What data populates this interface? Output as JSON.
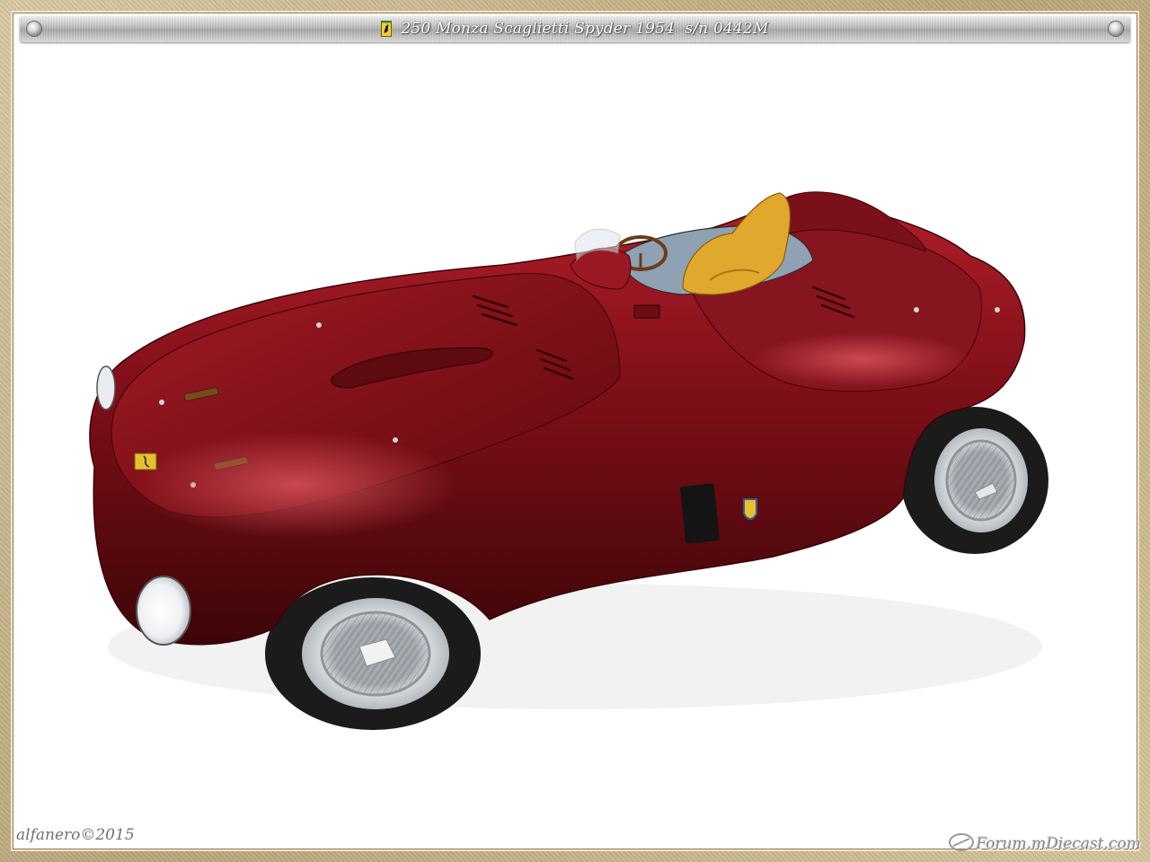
{
  "title_bar": {
    "title": "250 Monza Scaglietti Spyder 1954  s/n 0442M",
    "emblem_icon": "prancing-horse-badge-icon"
  },
  "watermark": {
    "signature": "alfanero©2015",
    "forum": "Forum.mDiecast.com"
  },
  "photo": {
    "subject": "car-model",
    "colors": {
      "body": "#7a0f17",
      "seats": "#e0a82c",
      "interior": "#8fa2b3",
      "wheel_rim": "#c9cdd1",
      "tire": "#1c1c1c"
    }
  }
}
